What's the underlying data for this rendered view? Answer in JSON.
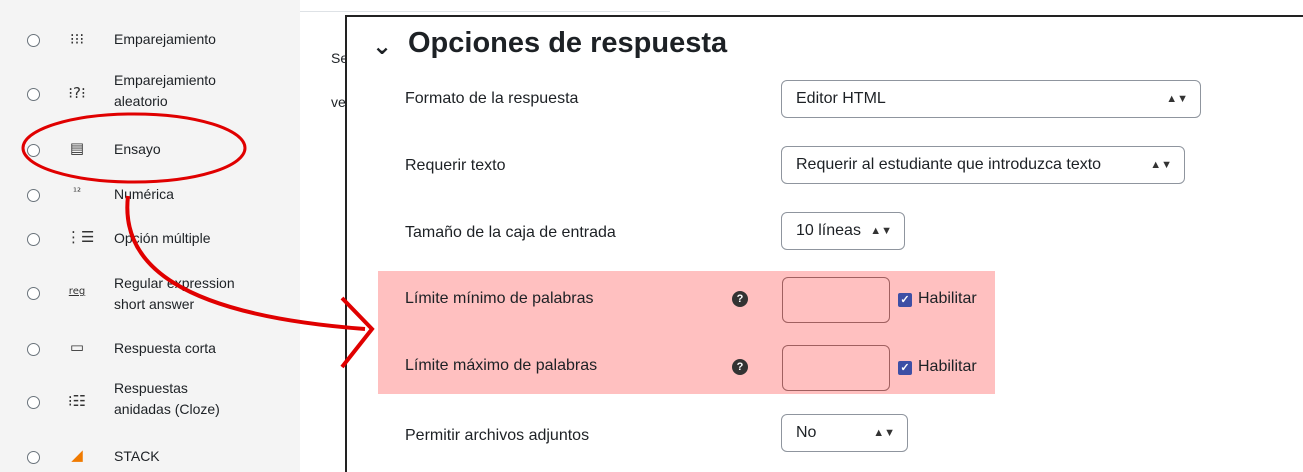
{
  "question_types": [
    {
      "label_lines": [
        "Emparejamiento"
      ],
      "icon": "⁝⁝⁝"
    },
    {
      "label_lines": [
        "Emparejamiento",
        "aleatorio"
      ],
      "icon": "⁝?⁝"
    },
    {
      "label_lines": [
        "Ensayo"
      ],
      "icon": "▤"
    },
    {
      "label_lines": [
        "Numérica"
      ],
      "icon": "¹²"
    },
    {
      "label_lines": [
        "Opción múltiple"
      ],
      "icon": "⋮☰"
    },
    {
      "label_lines": [
        "Regular expression",
        "short answer"
      ],
      "icon": "reg"
    },
    {
      "label_lines": [
        "Respuesta corta"
      ],
      "icon": "▭"
    },
    {
      "label_lines": [
        "Respuestas",
        "anidadas (Cloze)"
      ],
      "icon": "⁝☷"
    },
    {
      "label_lines": [
        "STACK"
      ],
      "icon": "◢"
    }
  ],
  "partial_text": {
    "line1": "Se",
    "line2": "ve"
  },
  "section": {
    "title": "Opciones de respuesta"
  },
  "fields": {
    "format": {
      "label": "Formato de la respuesta",
      "value": "Editor HTML"
    },
    "require_text": {
      "label": "Requerir texto",
      "value": "Requerir al estudiante que introduzca texto"
    },
    "box_size": {
      "label": "Tamaño de la caja de entrada",
      "value": "10 líneas"
    },
    "min_words": {
      "label": "Límite mínimo de palabras",
      "value": "",
      "enable_label": "Habilitar",
      "enabled": true
    },
    "max_words": {
      "label": "Límite máximo de palabras",
      "value": "",
      "enable_label": "Habilitar",
      "enabled": true
    },
    "attachments": {
      "label": "Permitir archivos adjuntos",
      "value": "No"
    }
  },
  "colors": {
    "highlight": "#ffc0c0",
    "annotation": "#e00000",
    "checkbox": "#3d4fa5"
  }
}
